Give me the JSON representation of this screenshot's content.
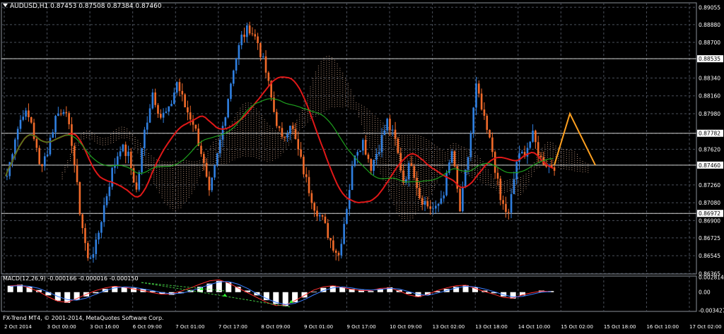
{
  "window": {
    "symbol_line": "AUDUSD,H1  0.87453 0.87508 0.87384 0.87460",
    "copyright": "FX-Trend MT4, © 2001-2014, MetaQuotes Software Corp."
  },
  "indicator": {
    "label": "MACD(12,26,9) -0.000166 -0.000016 -0.000150"
  },
  "colors": {
    "background": "#000000",
    "grid": "#4a4f5a",
    "bull_candle": "#2f7fe0",
    "bear_candle": "#f06a2a",
    "price_axis_text": "#ffffff",
    "ma_fast": "#e01818",
    "ma_slow": "#1ea01e",
    "ichimoku_cloud": "#e8b89a",
    "zigzag": "#ffa020",
    "macd_hist": "#ffffff",
    "macd_line": "#ff3030",
    "signal_line": "#3a7dff",
    "divergence": "#40c040",
    "arrow": "#30ff30"
  },
  "chart_data": {
    "type": "candlestick",
    "price_axis": {
      "ticks": [
        "0.89055",
        "0.88880",
        "0.88700",
        "0.88535",
        "0.88340",
        "0.88160",
        "0.87980",
        "0.87782",
        "0.87620",
        "0.87460",
        "0.87260",
        "0.87080",
        "0.86972",
        "0.86900",
        "0.86725",
        "0.86545",
        "0.86365"
      ],
      "ylim": [
        0.8636,
        0.891
      ],
      "highlighted_levels": [
        "0.88535",
        "0.87782",
        "0.87460",
        "0.86972"
      ]
    },
    "time_axis": {
      "ticks": [
        "2 Oct 2014",
        "3 Oct 00:00",
        "3 Oct 16:00",
        "6 Oct 09:00",
        "7 Oct 01:00",
        "7 Oct 17:00",
        "8 Oct 09:00",
        "9 Oct 01:00",
        "9 Oct 17:00",
        "10 Oct 09:00",
        "13 Oct 02:00",
        "13 Oct 18:00",
        "14 Oct 10:00",
        "15 Oct 02:00",
        "15 Oct 18:00",
        "16 Oct 10:00",
        "17 Oct 02:00"
      ]
    },
    "horizontal_lines": [
      0.88535,
      0.87782,
      0.8746,
      0.86972
    ],
    "price_path": [
      0.8735,
      0.8775,
      0.88,
      0.879,
      0.8745,
      0.876,
      0.8795,
      0.8805,
      0.877,
      0.87,
      0.865,
      0.8665,
      0.8705,
      0.874,
      0.8765,
      0.8755,
      0.872,
      0.878,
      0.882,
      0.8795,
      0.88,
      0.883,
      0.8805,
      0.879,
      0.876,
      0.8715,
      0.8755,
      0.88,
      0.8845,
      0.8875,
      0.8885,
      0.887,
      0.884,
      0.88,
      0.877,
      0.879,
      0.876,
      0.873,
      0.8705,
      0.869,
      0.867,
      0.8655,
      0.8705,
      0.876,
      0.877,
      0.8745,
      0.8765,
      0.879,
      0.877,
      0.873,
      0.875,
      0.8715,
      0.8705,
      0.87,
      0.872,
      0.876,
      0.87,
      0.8755,
      0.8825,
      0.879,
      0.876,
      0.871,
      0.8695,
      0.875,
      0.876,
      0.8775,
      0.8752,
      0.8746
    ],
    "zigzag": [
      [
        0.8746,
        0.8748
      ],
      [
        0.8781,
        0.8798
      ],
      [
        0.8822,
        0.8746
      ]
    ],
    "indicator": {
      "name": "MACD(12,26,9)",
      "ticks": [
        "0.002814",
        "0.00",
        "-0.003427"
      ],
      "ylim": [
        -0.0036,
        0.003
      ],
      "histogram": [
        0.0012,
        0.0014,
        0.001,
        0.0004,
        -0.0006,
        -0.0016,
        -0.002,
        -0.0015,
        -0.0008,
        -0.0002,
        0.0006,
        0.0011,
        0.001,
        0.0008,
        0.0006,
        0.0002,
        -0.0003,
        -0.0005,
        -0.0002,
        0.0004,
        0.001,
        0.0016,
        0.0021,
        0.0018,
        0.001,
        0.0003,
        -0.0006,
        -0.0015,
        -0.0022,
        -0.0026,
        -0.0019,
        -0.001,
        0.0001,
        0.0008,
        0.0012,
        0.001,
        0.0006,
        0.0004,
        0.0002,
        0.0006,
        0.0009,
        0.0004,
        -0.0003,
        -0.0009,
        -0.0005,
        0.0002,
        0.0006,
        0.001,
        0.0013,
        0.0009,
        0.0003,
        -0.0002,
        -0.0008,
        -0.0012,
        -0.0006,
        0.0,
        0.0003,
        0.0002
      ],
      "macd": [
        0.0012,
        0.0013,
        0.0008,
        0.0001,
        -0.0009,
        -0.0017,
        -0.0019,
        -0.0012,
        -0.0004,
        0.0003,
        0.0008,
        0.0011,
        0.0009,
        0.0006,
        0.0003,
        -0.0001,
        -0.0004,
        -0.0003,
        0.0002,
        0.0008,
        0.0015,
        0.0021,
        0.0023,
        0.0017,
        0.0008,
        -0.0001,
        -0.001,
        -0.0019,
        -0.0025,
        -0.0024,
        -0.0016,
        -0.0006,
        0.0004,
        0.001,
        0.0012,
        0.0009,
        0.0005,
        0.0003,
        0.0003,
        0.0007,
        0.0008,
        0.0002,
        -0.0005,
        -0.0009,
        -0.0004,
        0.0003,
        0.0008,
        0.0012,
        0.0013,
        0.0007,
        0.0001,
        -0.0004,
        -0.001,
        -0.0011,
        -0.0005,
        -0.0001,
        0.0002,
        0.0001
      ],
      "signal": [
        0.0011,
        0.0012,
        0.0011,
        0.0007,
        0.0,
        -0.0008,
        -0.0014,
        -0.0015,
        -0.0011,
        -0.0004,
        0.0003,
        0.0008,
        0.001,
        0.0009,
        0.0006,
        0.0003,
        -0.0001,
        -0.0003,
        -0.0002,
        0.0002,
        0.0008,
        0.0014,
        0.0019,
        0.002,
        0.0015,
        0.0007,
        -0.0003,
        -0.0012,
        -0.0019,
        -0.0023,
        -0.0021,
        -0.0014,
        -0.0005,
        0.0003,
        0.0008,
        0.001,
        0.0008,
        0.0005,
        0.0004,
        0.0005,
        0.0007,
        0.0006,
        0.0001,
        -0.0004,
        -0.0006,
        -0.0002,
        0.0003,
        0.0008,
        0.0011,
        0.001,
        0.0006,
        0.0001,
        -0.0005,
        -0.0009,
        -0.0008,
        -0.0004,
        0.0,
        0.0001
      ]
    }
  }
}
